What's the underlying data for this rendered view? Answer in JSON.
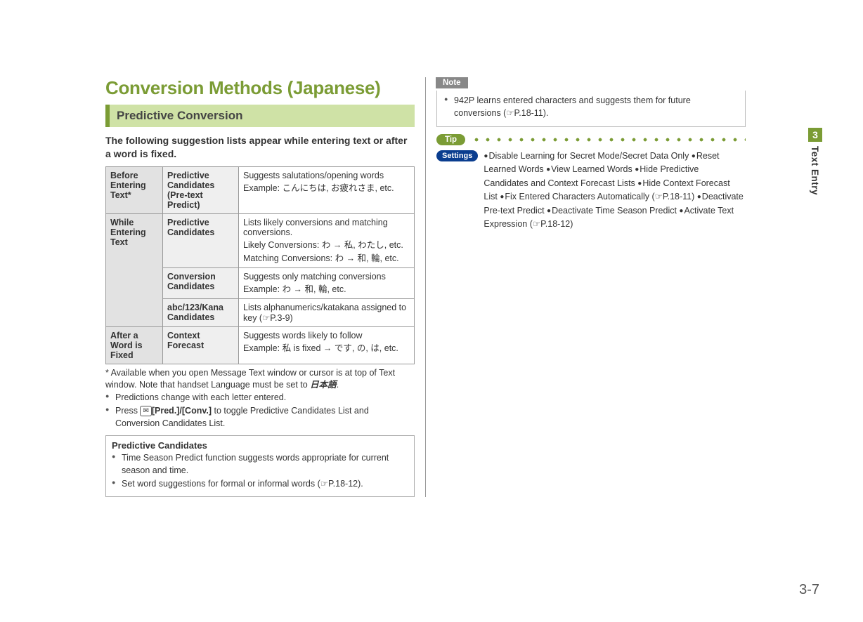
{
  "title": "Conversion Methods (Japanese)",
  "section": "Predictive Conversion",
  "intro": "The following suggestion lists appear while entering text or after a word is fixed.",
  "table": {
    "r1_phase": "Before Entering Text*",
    "r1_type": "Predictive Candidates (Pre-text Predict)",
    "r1_desc1": "Suggests salutations/opening words",
    "r1_desc2": "Example: こんにちは, お疲れさま, etc.",
    "r2_phase": "While Entering Text",
    "r2a_type": "Predictive Candidates",
    "r2a_desc1": "Lists likely conversions and matching conversions.",
    "r2a_desc2": "Likely Conversions: わ → 私, わたし, etc.",
    "r2a_desc3": "Matching Conversions: わ → 和, 輪, etc.",
    "r2b_type": "Conversion Candidates",
    "r2b_desc1": "Suggests only matching conversions",
    "r2b_desc2": "Example: わ → 和, 輪, etc.",
    "r2c_type": "abc/123/Kana Candidates",
    "r2c_desc": "Lists alphanumerics/katakana assigned to key (☞P.3-9)",
    "r3_phase": "After a Word is Fixed",
    "r3_type": "Context Forecast",
    "r3_desc1": "Suggests words likely to follow",
    "r3_desc2": "Example: 私 is fixed → です, の, は, etc."
  },
  "footnote": "* Available when you open Message Text window or cursor is at top of Text window. Note that handset Language must be set to ",
  "footnote_jp": "日本語",
  "footnote_end": ".",
  "bullet1": "Predictions change with each letter entered.",
  "bullet2a": "Press ",
  "bullet2key": "✉",
  "bullet2b": "[Pred.]/[Conv.]",
  "bullet2c": " to toggle Predictive Candidates List and Conversion Candidates List.",
  "pcbox": {
    "title": "Predictive Candidates",
    "b1": "Time Season Predict function suggests words appropriate for current season and time.",
    "b2": "Set word suggestions for formal or informal words (☞P.18-12)."
  },
  "note": {
    "tag": "Note",
    "text": "942P learns entered characters and suggests them for future conversions (☞P.18-11)."
  },
  "tip": {
    "tag": "Tip",
    "settings_tag": "Settings",
    "items": [
      "Disable Learning for Secret Mode/Secret Data Only",
      "Reset Learned Words",
      "View Learned Words",
      "Hide Predictive Candidates and Context Forecast Lists",
      "Hide Context Forecast List",
      "Fix Entered Characters Automatically (☞P.18-11)",
      "Deactivate Pre-text Predict",
      "Deactivate Time Season Predict",
      "Activate Text Expression (☞P.18-12)"
    ]
  },
  "sidebar": {
    "chapter": "3",
    "label": "Text Entry"
  },
  "pagenum": "3-7"
}
